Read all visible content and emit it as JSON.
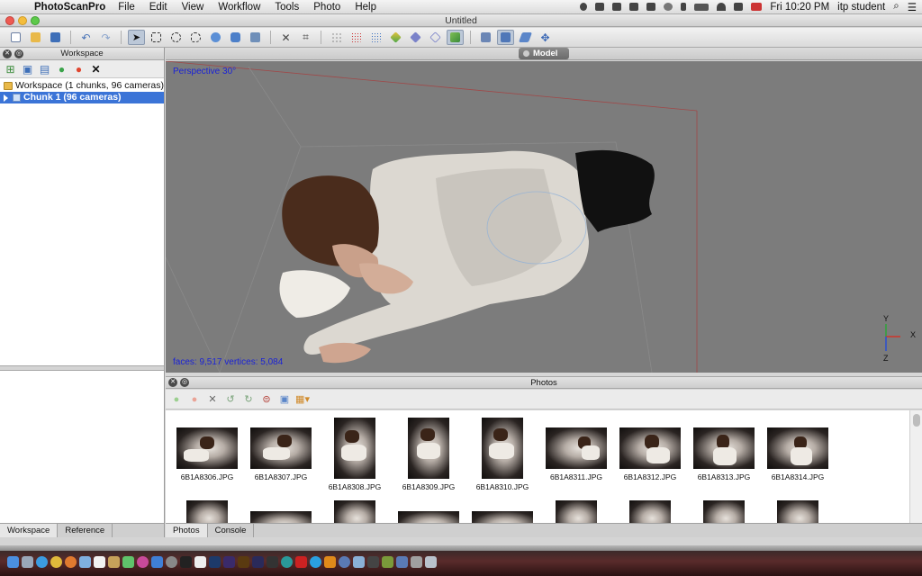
{
  "menubar": {
    "app_name": "PhotoScanPro",
    "menus": [
      "File",
      "Edit",
      "View",
      "Workflow",
      "Tools",
      "Photo",
      "Help"
    ],
    "clock": "Fri 10:20 PM",
    "user": "itp student"
  },
  "window": {
    "title": "Untitled"
  },
  "workspace": {
    "title": "Workspace",
    "root_label": "Workspace (1 chunks, 96 cameras)",
    "chunk_label": "Chunk 1 (96 cameras)",
    "tabs": [
      "Workspace",
      "Reference"
    ]
  },
  "model": {
    "tab_label": "Model",
    "perspective_label": "Perspective 30°",
    "stats_label": "faces: 9,517 vertices: 5,084",
    "axes": [
      "Y",
      "X",
      "Z"
    ]
  },
  "photos": {
    "title": "Photos",
    "tabs": [
      "Photos",
      "Console"
    ],
    "items": [
      "6B1A8306.JPG",
      "6B1A8307.JPG",
      "6B1A8308.JPG",
      "6B1A8309.JPG",
      "6B1A8310.JPG",
      "6B1A8311.JPG",
      "6B1A8312.JPG",
      "6B1A8313.JPG",
      "6B1A8314.JPG"
    ]
  },
  "colors": {
    "selection": "#3b74d7",
    "viewport_bg": "#7c7c7c",
    "overlay_text": "#1a22d6"
  }
}
